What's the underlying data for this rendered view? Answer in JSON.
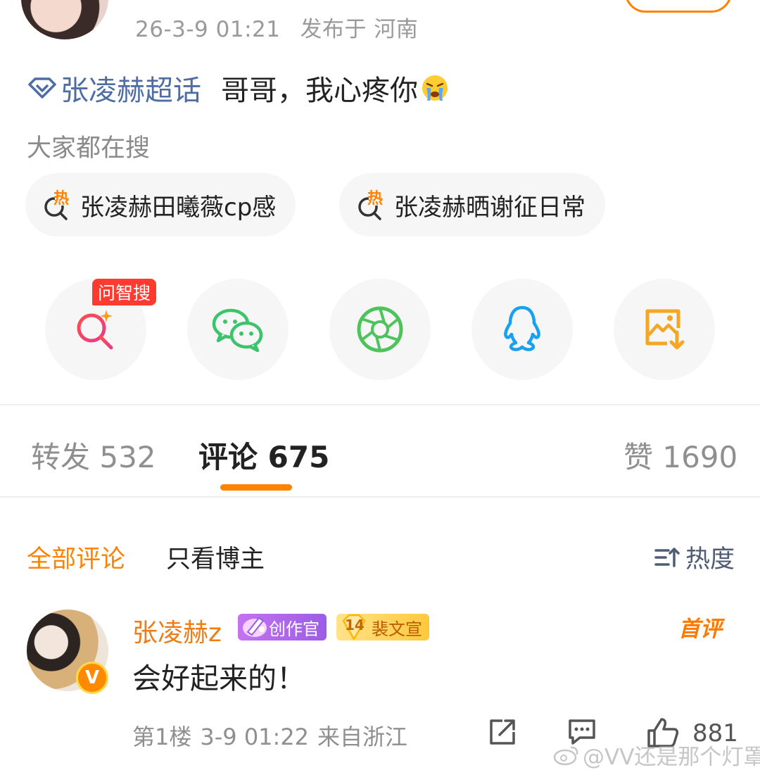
{
  "post": {
    "time": "26-3-9 01:21",
    "location": "发布于 河南",
    "topic": "张凌赫超话",
    "text": "哥哥，我心疼你",
    "emoji": "crying-face"
  },
  "search": {
    "label": "大家都在搜",
    "chips": [
      {
        "hot": "热",
        "text": "张凌赫田曦薇cp感"
      },
      {
        "hot": "热",
        "text": "张凌赫晒谢征日常"
      }
    ]
  },
  "share": {
    "ai_badge": "问智搜",
    "buttons": [
      "ai-search-icon",
      "wechat-icon",
      "moments-icon",
      "qq-icon",
      "save-image-icon"
    ]
  },
  "tabs": {
    "repost": "转发 532",
    "comments": "评论 675",
    "likes": "赞 1690"
  },
  "filters": {
    "all": "全部评论",
    "author_only": "只看博主",
    "sort": "热度"
  },
  "comment": {
    "user": "张凌赫z",
    "badge_creator": "创作官",
    "badge_level": "14",
    "badge_fan": "裴文宣",
    "first_tag": "首评",
    "text": "会好起来的！",
    "floor": "第1楼",
    "time": "3-9 01:22",
    "from": "来自浙江",
    "likes": "881"
  },
  "watermark": "@VV还是那个灯罩",
  "colors": {
    "accent": "#ff8200",
    "topic": "#4e6ea3",
    "name": "#f07b14"
  }
}
